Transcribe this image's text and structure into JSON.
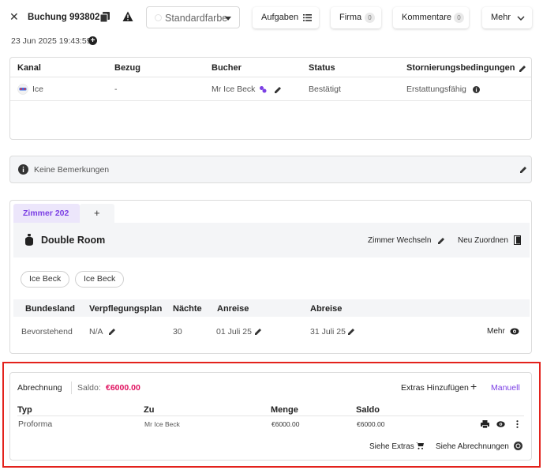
{
  "header": {
    "title": "Buchung 993802",
    "color_select": "Standardfarbe",
    "buttons": {
      "tasks": "Aufgaben",
      "company": "Firma",
      "company_count": "0",
      "comments": "Kommentare",
      "comments_count": "0",
      "more": "Mehr"
    },
    "timestamp": "23 Jun 2025 19:43:59"
  },
  "booking_table": {
    "headers": [
      "Kanal",
      "Bezug",
      "Bucher",
      "Status",
      "Stornierungsbedingungen"
    ],
    "row": {
      "channel": "Ice",
      "reference": "-",
      "booker": "Mr Ice Beck",
      "status": "Bestätigt",
      "cancellation": "Erstattungsfähig"
    }
  },
  "remarks": {
    "text": "Keine Bemerkungen"
  },
  "room": {
    "tab_label": "Zimmer 202",
    "add_tab": "+",
    "room_type": "Double Room",
    "change_room": "Zimmer Wechseln",
    "reassign": "Neu Zuordnen",
    "guests": [
      "Ice Beck",
      "Ice Beck"
    ],
    "headers": [
      "Bundesland",
      "Verpflegungsplan",
      "Nächte",
      "Anreise",
      "Abreise"
    ],
    "row": {
      "state": "Bevorstehend",
      "meal_plan": "N/A",
      "nights": "30",
      "arrival": "01 Juli 25",
      "departure": "31 Juli 25",
      "more": "Mehr"
    }
  },
  "billing": {
    "title": "Abrechnung",
    "balance_label": "Saldo:",
    "balance_value": "€6000.00",
    "add_extras": "Extras Hinzufügen",
    "manual": "Manuell",
    "headers": [
      "Typ",
      "Zu",
      "Menge",
      "Saldo"
    ],
    "row": {
      "type": "Proforma",
      "to": "Mr Ice Beck",
      "amount": "€6000.00",
      "balance": "€6000.00"
    },
    "see_extras": "Siehe Extras",
    "see_invoices": "Siehe Abrechnungen"
  },
  "colors": {
    "accent_purple": "#7b3fe4",
    "balance_red": "#e0115f",
    "highlight_red": "#e3221c",
    "tab_bg": "#ece6fb"
  }
}
